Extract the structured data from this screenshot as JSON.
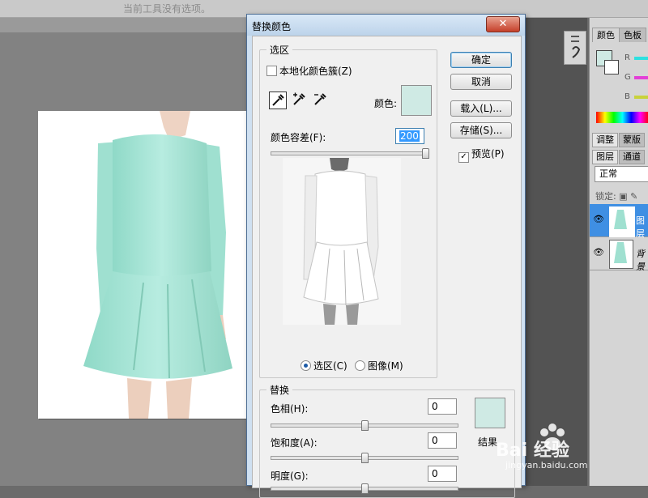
{
  "options_bar": {
    "message": "当前工具没有选项。"
  },
  "dialog": {
    "title": "替换颜色",
    "close_label": "✕",
    "selection": {
      "legend": "选区",
      "localized_clusters_label": "本地化颜色簇(Z)",
      "localized_clusters_checked": false,
      "color_label": "颜色:",
      "swatch_color": "#cfeae4",
      "fuzziness_label": "颜色容差(F):",
      "fuzziness_value": "200",
      "fuzziness_fraction": 1.0,
      "radio_selection": "选区(C)",
      "radio_image": "图像(M)",
      "selected_view": "selection"
    },
    "buttons": {
      "ok": "确定",
      "cancel": "取消",
      "load": "载入(L)...",
      "save": "存储(S)..."
    },
    "preview_label": "预览(P)",
    "preview_checked": true,
    "replace": {
      "legend": "替换",
      "hue_label": "色相(H):",
      "hue_value": "0",
      "saturation_label": "饱和度(A):",
      "saturation_value": "0",
      "lightness_label": "明度(G):",
      "lightness_value": "0",
      "result_label": "结果",
      "result_color": "#cfeae4"
    }
  },
  "color_panel": {
    "tabs": [
      "颜色",
      "色板"
    ],
    "channels": [
      "R",
      "G",
      "B"
    ],
    "fg_color": "#cfeae4"
  },
  "layers_panel": {
    "tabs_top": [
      "调整",
      "蒙版"
    ],
    "tabs": [
      "图层",
      "通道"
    ],
    "blend_mode": "正常",
    "lock_label": "锁定:",
    "layers": [
      {
        "name": "图层"
      },
      {
        "name": "背景"
      }
    ]
  },
  "watermark": {
    "brand": "Bai 经验",
    "url": "jingyan.baidu.com"
  }
}
